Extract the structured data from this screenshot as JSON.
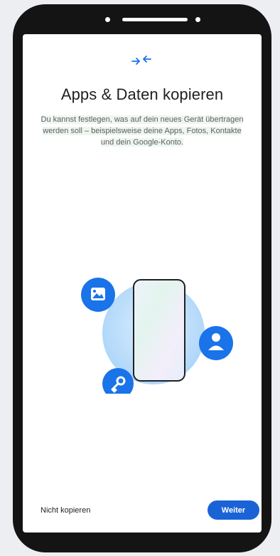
{
  "screen": {
    "title": "Apps & Daten kopieren",
    "description": "Du kannst festlegen, was auf dein neues Gerät übertragen werden soll – beispielsweise deine Apps, Fotos, Kontakte und dein Google-Konto."
  },
  "icons": {
    "header": "transfer-arrows-icon",
    "photos": "image-icon",
    "contacts": "person-icon",
    "account": "key-icon"
  },
  "actions": {
    "skip_label": "Nicht kopieren",
    "next_label": "Weiter"
  },
  "colors": {
    "accent": "#1a63d6",
    "icon_blue": "#1a73e8",
    "blob": "#bfe0fb"
  }
}
